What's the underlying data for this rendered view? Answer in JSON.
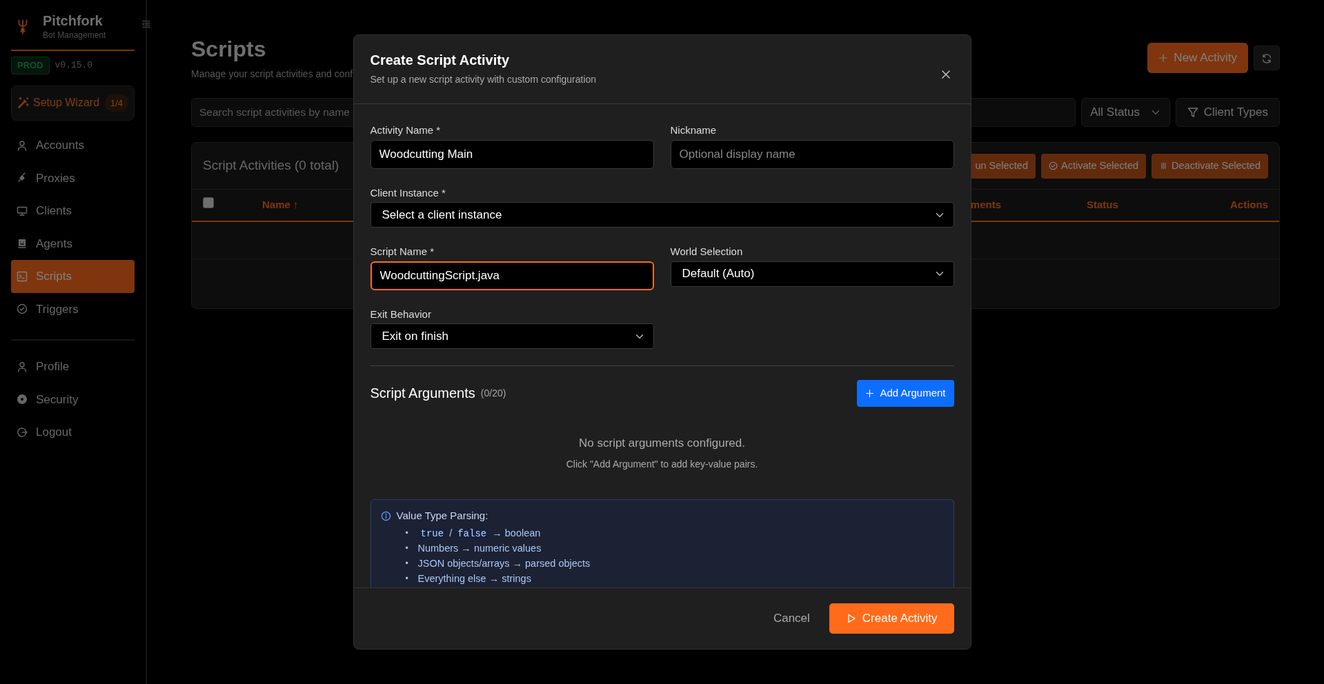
{
  "sidebar": {
    "brand": "Pitchfork",
    "tagline": "Bot Management",
    "env_badge": "PROD",
    "version": "v0.15.0",
    "setup_wizard": {
      "label": "Setup Wizard",
      "progress": "1/4"
    },
    "nav": [
      {
        "label": "Accounts",
        "selected": false
      },
      {
        "label": "Proxies",
        "selected": false
      },
      {
        "label": "Clients",
        "selected": false
      },
      {
        "label": "Agents",
        "selected": false
      },
      {
        "label": "Scripts",
        "selected": true
      },
      {
        "label": "Triggers",
        "selected": false
      }
    ],
    "account_nav": [
      {
        "label": "Profile"
      },
      {
        "label": "Security"
      },
      {
        "label": "Logout"
      }
    ]
  },
  "page": {
    "title": "Scripts",
    "subtitle": "Manage your script activities and conf",
    "new_button": "New Activity",
    "search_placeholder": "Search script activities by name",
    "status_filter": "All Status",
    "client_types_button": "Client Types",
    "table_card": {
      "title": "Script Activities (0 total)",
      "bulk_actions": [
        {
          "label": "un Selected"
        },
        {
          "label": "Activate Selected"
        },
        {
          "label": "Deactivate Selected"
        }
      ],
      "columns": [
        {
          "kind": "checkbox",
          "checked": false
        },
        {
          "kind": "text",
          "label": "Name ↑"
        },
        {
          "kind": "text",
          "label": "ments"
        },
        {
          "kind": "text",
          "label": "Status"
        },
        {
          "kind": "text",
          "label": "Actions"
        }
      ]
    }
  },
  "modal": {
    "title": "Create Script Activity",
    "subtitle": "Set up a new script activity with custom configuration",
    "fields": [
      {
        "label": "Activity Name *",
        "kind": "text",
        "value": "Woodcutting Main",
        "focused": false
      },
      {
        "label": "Nickname",
        "kind": "text",
        "placeholder": "Optional display name",
        "focused": false
      },
      {
        "label": "Client Instance *",
        "kind": "select",
        "value": "Select a client instance",
        "focused": false
      },
      {
        "label": "Script Name *",
        "kind": "text",
        "value": "WoodcuttingScript.java",
        "focused": true
      },
      {
        "label": "World Selection",
        "kind": "select",
        "value": "Default (Auto)",
        "focused": false
      },
      {
        "label": "Exit Behavior",
        "kind": "select",
        "value": "Exit on finish",
        "focused": false
      }
    ],
    "arguments": {
      "title": "Script Arguments",
      "count": "(0/20)",
      "add_button": "Add Argument",
      "empty_title": "No script arguments configured.",
      "empty_hint": "Click \"Add Argument\" to add key-value pairs."
    },
    "info": {
      "title": "Value Type Parsing:",
      "items": [
        {
          "marker": "•",
          "parts": [
            {
              "kind": "code",
              "text": "true"
            },
            {
              "kind": "text",
              "text": "/"
            },
            {
              "kind": "code",
              "text": "false"
            },
            {
              "kind": "text",
              "text": "→ boolean"
            }
          ]
        },
        {
          "marker": "•",
          "parts": [
            {
              "kind": "text",
              "text": "Numbers → numeric values"
            }
          ]
        },
        {
          "marker": "•",
          "parts": [
            {
              "kind": "text",
              "text": "JSON objects/arrays → parsed objects"
            }
          ]
        },
        {
          "marker": "•",
          "parts": [
            {
              "kind": "text",
              "text": "Everything else → strings"
            }
          ]
        }
      ]
    },
    "footer": {
      "cancel": "Cancel",
      "submit": "Create Activity"
    }
  }
}
